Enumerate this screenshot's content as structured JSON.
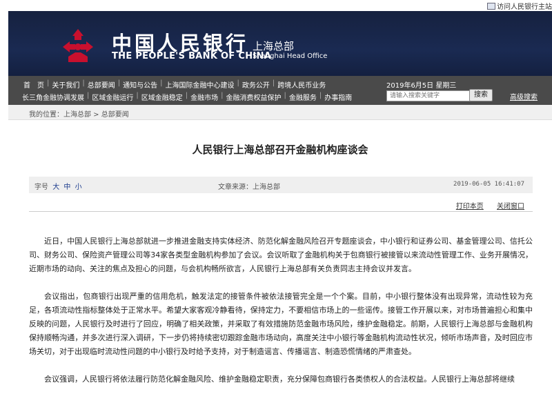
{
  "topbar": {
    "visit_link": "访问人民银行主站"
  },
  "header": {
    "brand_cn": "中国人民银行",
    "brand_en": "THE PEOPLE'S BANK OF CHINA",
    "sub_cn": "上海总部",
    "sub_en": "Shanghai Head Office",
    "bg_color": "#16213f",
    "emblem_color": "#c8102e"
  },
  "nav": {
    "row1": [
      "首　页",
      "关于我们",
      "总部要闻",
      "通知与公告",
      "上海国际金融中心建设",
      "政务公开",
      "跨境人民币业务"
    ],
    "row2": [
      "长三角金融协调发展",
      "区域金融运行",
      "区域金融稳定",
      "金融市场",
      "金融消费权益保护",
      "金融服务",
      "办事指南"
    ],
    "date": "2019年6月5日 星期三",
    "search_placeholder": "请输入搜索关键字",
    "search_button": "搜索",
    "advanced_search": "高级搜索"
  },
  "breadcrumb": {
    "label": "我的位置：",
    "items": [
      "上海总部",
      "总部要闻"
    ],
    "sep": " > "
  },
  "article": {
    "title": "人民银行上海总部召开金融机构座谈会",
    "font_size_label": "字号",
    "font_sizes": [
      "大",
      "中",
      "小"
    ],
    "source": "文章来源：上海总部",
    "datetime": "2019-06-05  16:41:07",
    "print": "打印本页",
    "close": "关闭窗口",
    "paragraphs": [
      "近日，中国人民银行上海总部就进一步推进金融支持实体经济、防范化解金融风险召开专题座谈会，中小银行和证券公司、基金管理公司、信托公司、财务公司、保险资产管理公司等34家各类型金融机构参加了会议。会议听取了金融机构关于包商银行被接管以来流动性管理工作、业务开展情况，近期市场的动向、关注的焦点及担心的问题，与会机构畅所欲言，人民银行上海总部有关负责同志主持会议并发言。",
      "会议指出，包商银行出现严重的信用危机，触发法定的接管条件被依法接管完全是一个个案。目前，中小银行整体没有出现异常，流动性较为充足，各项流动性指标整体处于正常水平。希望大家客观冷静看待，保持定力，不要相信市场上的一些谣传。接管工作开展以来，对市场普遍担心和集中反映的问题，人民银行及时进行了回应，明确了相关政策，并采取了有效措施防范金融市场风险，维护金融稳定。前期，人民银行上海总部与金融机构保持顺畅沟通，并多次进行深入调研，下一步仍将持续密切跟踪金融市场动向，高度关注中小银行等金融机构流动性状况，倾听市场声音，及时回应市场关切，对于出现临时流动性问题的中小银行及时给予支持，对于制造谣言、传播谣言、制造恐慌情绪的严肃查处。",
      "会议强调，人民银行将依法履行防范化解金融风险、维护金融稳定职责，充分保障包商银行各类债权人的合法权益。人民银行上海总部将继续"
    ]
  }
}
